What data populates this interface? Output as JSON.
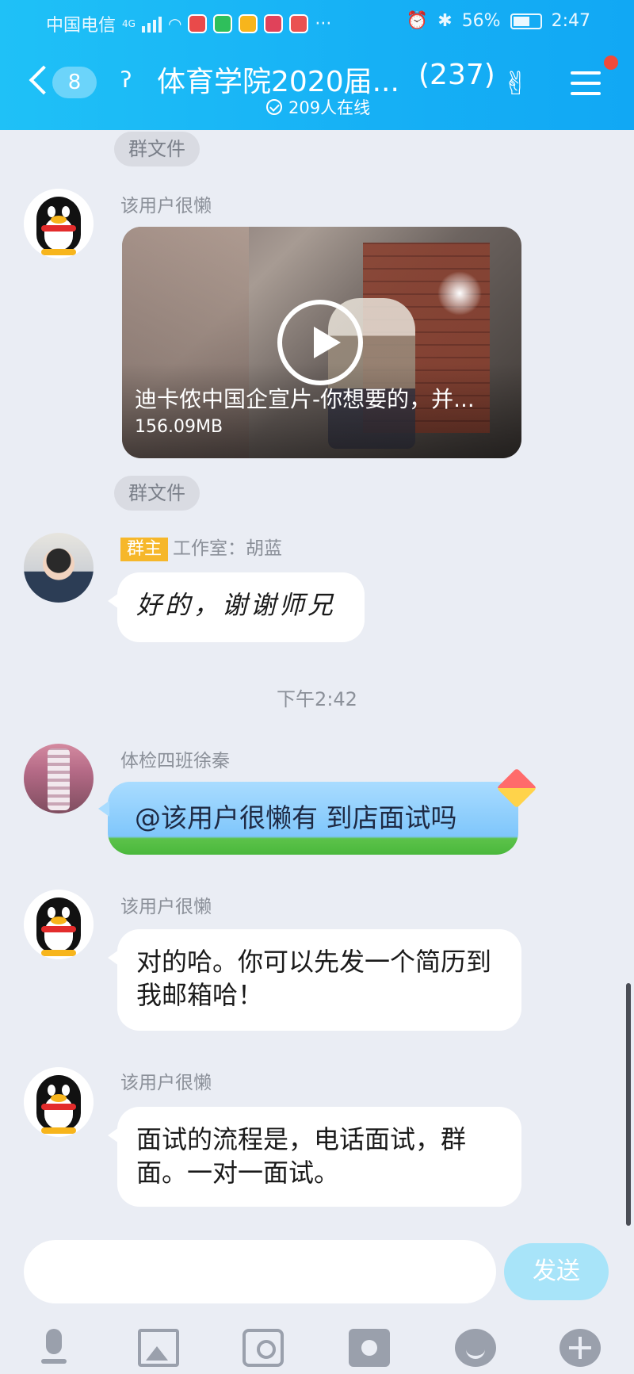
{
  "status_bar": {
    "carrier": "中国电信",
    "network": "4G",
    "battery": "56%",
    "time": "2:47"
  },
  "header": {
    "unread_count": "8",
    "title": "体育学院2020届...",
    "member_count": "(237)",
    "online_text": "209人在线"
  },
  "messages": [
    {
      "type": "chip",
      "text": "群文件"
    },
    {
      "type": "video",
      "sender": "该用户很懒",
      "video_title": "迪卡侬中国企宣片-你想要的，并...",
      "video_size": "156.09MB"
    },
    {
      "type": "chip",
      "text": "群文件"
    },
    {
      "type": "text",
      "badge": "群主",
      "sender": "工作室：胡蓝",
      "text": "好的，谢谢师兄"
    },
    {
      "type": "time",
      "text": "下午2:42"
    },
    {
      "type": "text",
      "sender": "体检四班徐秦",
      "text": "@该用户很懒有 到店面试吗"
    },
    {
      "type": "text",
      "sender": "该用户很懒",
      "text": "对的哈。你可以先发一个简历到我邮箱哈！"
    },
    {
      "type": "text",
      "sender": "该用户很懒",
      "text": "面试的流程是，电话面试，群面。一对一面试。"
    }
  ],
  "input": {
    "placeholder": "",
    "send_label": "发送"
  },
  "colors": {
    "header": "#17b4f6",
    "background": "#eaedf4",
    "owner_badge": "#f6b72a",
    "send_button": "#a8e4f9"
  },
  "icons": [
    "back-icon",
    "ear-icon",
    "hand-icon",
    "menu-icon",
    "play-icon",
    "mic-icon",
    "image-icon",
    "camera-icon",
    "red-envelope-icon",
    "emoji-icon",
    "plus-icon"
  ]
}
